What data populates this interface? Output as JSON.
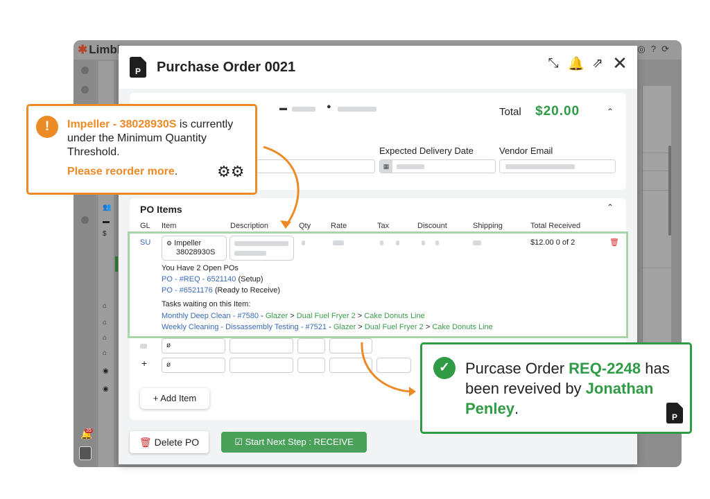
{
  "app": {
    "logo_text": "Limbl",
    "notification_count": "35"
  },
  "modal": {
    "title": "Purchase Order 0021",
    "header_icons": [
      "collapse-icon",
      "bell-icon",
      "share-icon",
      "close-icon"
    ],
    "summary": {
      "total_label": "Total",
      "total_value": "$20.00",
      "expected_delivery_label": "Expected Delivery Date",
      "vendor_email_label": "Vendor Email"
    },
    "items": {
      "title": "PO Items",
      "columns": [
        "GL",
        "Item",
        "Description",
        "Qty",
        "Rate",
        "Tax",
        "Discount",
        "Shipping",
        "Total Received"
      ],
      "row": {
        "gl": "SU",
        "item_name": "Impeller",
        "item_code": "38028930S",
        "total_received": "$12.00 0 of 2"
      },
      "open_pos_heading": "You Have 2 Open POs",
      "open_pos": [
        {
          "link": "PO - #REQ - 6521140",
          "status": "(Setup)"
        },
        {
          "link": "PO - #6521176",
          "status": "(Ready to Receive)"
        }
      ],
      "tasks_heading": "Tasks waiting on this Item:",
      "tasks": [
        {
          "task": "Monthly Deep Clean - #7580",
          "sep": " - ",
          "path": [
            "Glazer",
            "Dual Fuel Fryer 2",
            "Cake Donuts Line"
          ]
        },
        {
          "task": "Weekly Cleaning - Dissassembly Testing - #7521",
          "sep": " - ",
          "path": [
            "Glazer",
            "Dual Fuel Fryer 2",
            "Cake Donuts Line"
          ]
        }
      ],
      "row_symbol": "ø",
      "add_row_symbol": "+",
      "add_item_label": "+ Add Item"
    },
    "footer": {
      "delete_label": "Delete PO",
      "next_step_label": "Start Next Step : RECEIVE"
    }
  },
  "callout_warning": {
    "item_link": "Impeller - 38028930S",
    "message": " is currently under the Minimum Quantity Threshold.",
    "action": "Please reorder more",
    "action_suffix": ".",
    "color": "#ec8a26"
  },
  "callout_success": {
    "prefix": "Purcase Order ",
    "po_number": "REQ-2248",
    "middle": " has been reveived by ",
    "person": "Jonathan Penley",
    "suffix": ".",
    "color": "#2f9b45"
  }
}
